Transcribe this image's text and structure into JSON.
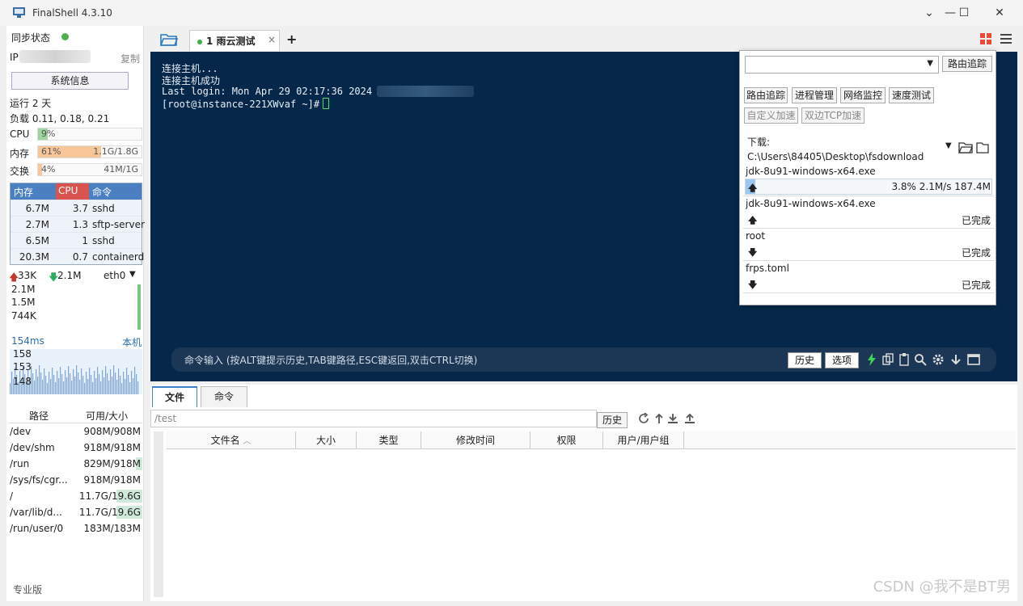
{
  "window": {
    "title": "FinalShell 4.3.10"
  },
  "sidebar": {
    "sync_label": "同步状态",
    "ip_label": "IP",
    "copy_label": "复制",
    "sysinfo_label": "系统信息",
    "uptime": "运行 2 天",
    "load": "负载 0.11, 0.18, 0.21",
    "metrics": [
      {
        "label": "CPU",
        "pct": "9%",
        "value": "",
        "fill": 0.09,
        "color": "#9fd39f"
      },
      {
        "label": "内存",
        "pct": "61%",
        "value": "1.1G/1.8G",
        "fill": 0.61,
        "color": "#f7c79a"
      },
      {
        "label": "交换",
        "pct": "4%",
        "value": "41M/1G",
        "fill": 0.04,
        "color": "#f7c79a"
      }
    ],
    "proc_headers": {
      "mem": "内存",
      "cpu": "CPU",
      "cmd": "命令"
    },
    "processes": [
      {
        "mem": "6.7M",
        "cpu": "3.7",
        "cmd": "sshd"
      },
      {
        "mem": "2.7M",
        "cpu": "1.3",
        "cmd": "sftp-server"
      },
      {
        "mem": "6.5M",
        "cpu": "1",
        "cmd": "sshd"
      },
      {
        "mem": "20.3M",
        "cpu": "0.7",
        "cmd": "containerd"
      }
    ],
    "net": {
      "up": "33K",
      "down": "2.1M",
      "iface": "eth0",
      "ticks": [
        "2.1M",
        "1.5M",
        "744K"
      ]
    },
    "ping": {
      "latency": "154ms",
      "target": "本机",
      "ticks": [
        "158",
        "153",
        "148"
      ]
    },
    "disk_headers": {
      "path": "路径",
      "size": "可用/大小"
    },
    "disks": [
      {
        "path": "/dev",
        "size": "908M/908M",
        "used": 0.0
      },
      {
        "path": "/dev/shm",
        "size": "918M/918M",
        "used": 0.0
      },
      {
        "path": "/run",
        "size": "829M/918M",
        "used": 0.1
      },
      {
        "path": "/sys/fs/cgr...",
        "size": "918M/918M",
        "used": 0.0
      },
      {
        "path": "/",
        "size": "11.7G/19.6G",
        "used": 0.4
      },
      {
        "path": "/var/lib/d...",
        "size": "11.7G/19.6G",
        "used": 0.4
      },
      {
        "path": "/run/user/0",
        "size": "183M/183M",
        "used": 0.0
      }
    ],
    "edition": "专业版"
  },
  "tabs": [
    {
      "label": "1 雨云测试",
      "close": "×"
    }
  ],
  "tab_add": "+",
  "terminal": {
    "lines": [
      "连接主机...",
      "连接主机成功",
      "Last login: Mon Apr 29 02:17:36 2024 f",
      "[root@instance-221XWvaf ~]#"
    ],
    "cmd_hint": "命令输入 (按ALT键提示历史,TAB键路径,ESC键返回,双击CTRL切换)",
    "history_btn": "历史",
    "options_btn": "选项"
  },
  "panel": {
    "trace_btn": "路由追踪",
    "buttons_row1": [
      "路由追踪",
      "进程管理",
      "网络监控",
      "速度测试"
    ],
    "buttons_row2": [
      "自定义加速",
      "双边TCP加速"
    ],
    "download_path": "下载: C:\\Users\\84405\\Desktop\\fsdownload",
    "downloads": [
      {
        "name": "jdk-8u91-windows-x64.exe",
        "arrow": "🡅",
        "status": "3.8% 2.1M/s 187.4M",
        "progress": 0.038
      },
      {
        "name": "jdk-8u91-windows-x64.exe",
        "arrow": "🡅",
        "status": "已完成"
      },
      {
        "name": "root",
        "arrow": "🡇",
        "status": "已完成"
      },
      {
        "name": "frps.toml",
        "arrow": "🡇",
        "status": "已完成"
      }
    ]
  },
  "files": {
    "tab_files": "文件",
    "tab_commands": "命令",
    "path": "/test",
    "history_btn": "历史",
    "columns": [
      "文件名",
      "大小",
      "类型",
      "修改时间",
      "权限",
      "用户/用户组"
    ]
  },
  "watermark": "CSDN @我不是BT男"
}
